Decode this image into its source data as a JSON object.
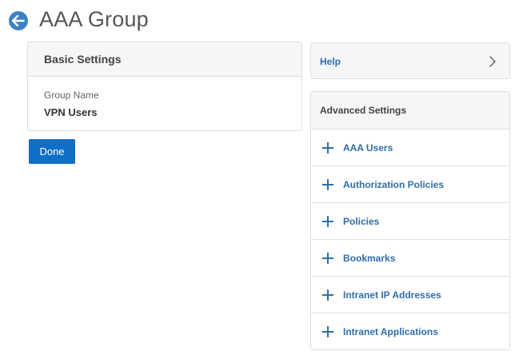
{
  "header": {
    "title": "AAA Group"
  },
  "basic_settings": {
    "heading": "Basic Settings",
    "group_name_label": "Group Name",
    "group_name_value": "VPN Users"
  },
  "actions": {
    "done_label": "Done"
  },
  "help": {
    "label": "Help"
  },
  "advanced_settings": {
    "heading": "Advanced Settings",
    "items": [
      {
        "label": "AAA Users"
      },
      {
        "label": "Authorization Policies"
      },
      {
        "label": "Policies"
      },
      {
        "label": "Bookmarks"
      },
      {
        "label": "Intranet IP Addresses"
      },
      {
        "label": "Intranet Applications"
      }
    ]
  },
  "colors": {
    "accent": "#0f6fc6",
    "link": "#2f6ea8",
    "back_button": "#3b82c4"
  },
  "icons": {
    "back": "arrow-left-icon",
    "help": "chevron-right-icon",
    "add": "plus-icon"
  }
}
